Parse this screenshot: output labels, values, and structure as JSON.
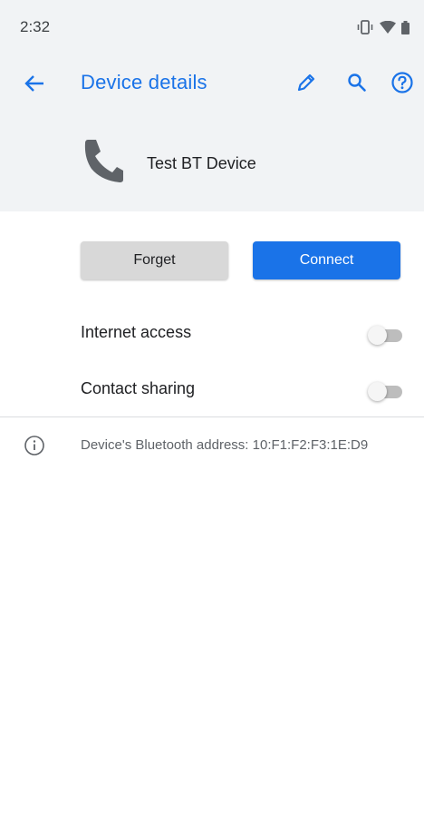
{
  "status_bar": {
    "time": "2:32",
    "icons": [
      "vibrate-icon",
      "wifi-icon",
      "battery-icon"
    ]
  },
  "app_bar": {
    "title": "Device details",
    "back_icon": "arrow-back-icon",
    "actions": [
      "edit-icon",
      "search-icon",
      "help-icon"
    ]
  },
  "device": {
    "icon": "phone-icon",
    "name": "Test BT Device"
  },
  "buttons": {
    "forget_label": "Forget",
    "connect_label": "Connect"
  },
  "preferences": [
    {
      "label": "Internet access",
      "enabled": false
    },
    {
      "label": "Contact sharing",
      "enabled": false
    }
  ],
  "info": {
    "icon": "info-icon",
    "text": "Device's Bluetooth address: 10:F1:F2:F3:1E:D9"
  },
  "colors": {
    "accent": "#1a73e8",
    "header_background": "#f1f3f5",
    "forget_button": "#d8d8d8"
  }
}
